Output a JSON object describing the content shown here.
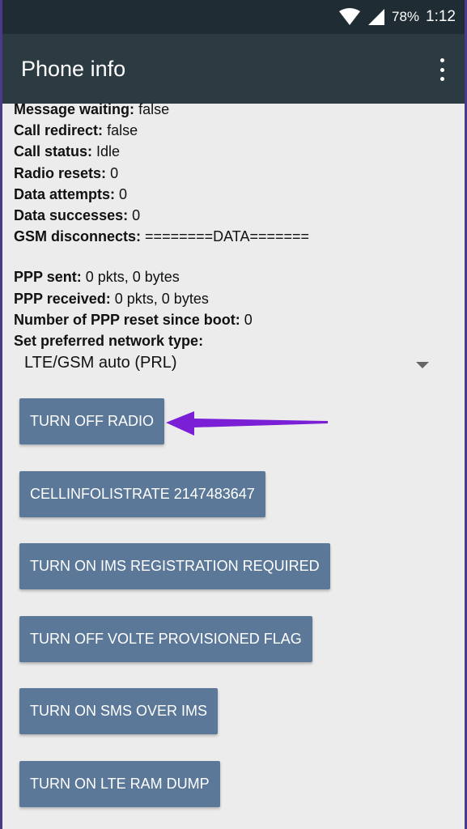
{
  "status_bar": {
    "battery": "78%",
    "time": "1:12",
    "icons": [
      "wifi-icon",
      "signal-icon"
    ]
  },
  "app_bar": {
    "title": "Phone info",
    "menu_icon": "overflow-menu-icon"
  },
  "info_rows": [
    {
      "label": "Message waiting:",
      "value": "false"
    },
    {
      "label": "Call redirect:",
      "value": "false"
    },
    {
      "label": "Call status:",
      "value": "Idle"
    },
    {
      "label": "Radio resets:",
      "value": "0"
    },
    {
      "label": "Data attempts:",
      "value": "0"
    },
    {
      "label": "Data successes:",
      "value": "0"
    },
    {
      "label": "GSM disconnects:",
      "value": "========DATA======="
    },
    {
      "label": "PPP sent:",
      "value": "0 pkts, 0 bytes"
    },
    {
      "label": "PPP received:",
      "value": "0 pkts, 0 bytes"
    },
    {
      "label": "Number of PPP reset since boot:",
      "value": "0"
    },
    {
      "label": "Set preferred network type:",
      "value": ""
    }
  ],
  "network_type": {
    "selected": "LTE/GSM auto (PRL)"
  },
  "buttons": [
    {
      "label": "TURN OFF RADIO"
    },
    {
      "label": "CELLINFOLISTRATE 2147483647"
    },
    {
      "label": "TURN ON IMS REGISTRATION REQUIRED"
    },
    {
      "label": "TURN OFF VOLTE PROVISIONED FLAG"
    },
    {
      "label": "TURN ON SMS OVER IMS"
    },
    {
      "label": "TURN ON LTE RAM DUMP"
    }
  ],
  "colors": {
    "status_bar": "#1f2c34",
    "app_bar": "#2c3a41",
    "button": "#5b7898",
    "annotation_arrow": "#7a1fd6",
    "background": "#ececec"
  }
}
